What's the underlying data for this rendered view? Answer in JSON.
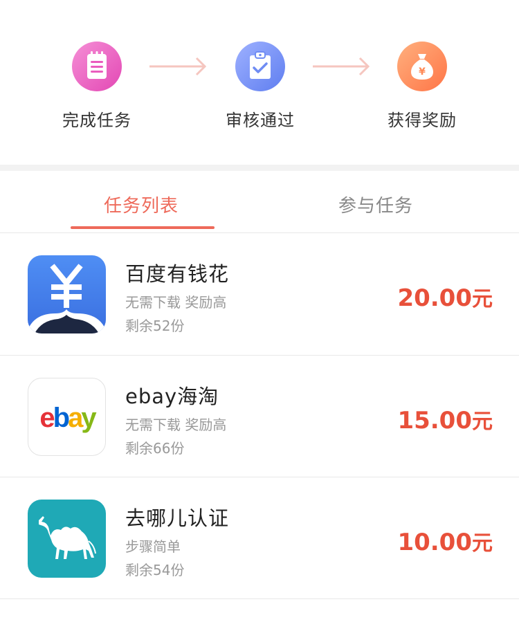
{
  "steps": [
    {
      "label": "完成任务",
      "icon": "clipboard-list-icon",
      "color": "#e348b4"
    },
    {
      "label": "审核通过",
      "icon": "clipboard-check-icon",
      "color": "#5f7ef0"
    },
    {
      "label": "获得奖励",
      "icon": "money-bag-icon",
      "color": "#ff7547"
    }
  ],
  "tabs": {
    "active": "任务列表",
    "inactive": "参与任务"
  },
  "tasks": [
    {
      "name": "百度有钱花",
      "desc": "无需下载 奖励高",
      "remaining": "剩余52份",
      "amount": "20.00",
      "unit": "元",
      "icon": "baidu-youqianhua-logo"
    },
    {
      "name": "ebay海淘",
      "desc": "无需下载 奖励高",
      "remaining": "剩余66份",
      "amount": "15.00",
      "unit": "元",
      "icon": "ebay-logo",
      "logo_text": "ebay"
    },
    {
      "name": "去哪儿认证",
      "desc": "步骤简单",
      "remaining": "剩余54份",
      "amount": "10.00",
      "unit": "元",
      "icon": "qunar-camel-logo"
    }
  ],
  "colors": {
    "accent": "#ee6a5a",
    "price": "#e8503a"
  }
}
